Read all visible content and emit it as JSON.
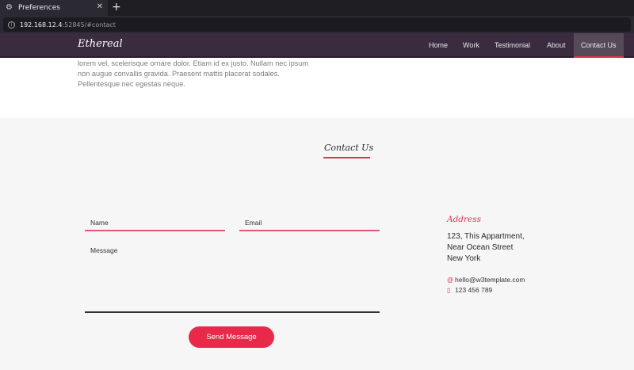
{
  "browser": {
    "tab_title": "Preferences",
    "tab_icon": "gear-icon",
    "url_host": "192.168.12.4",
    "url_rest": ":52845/#contact"
  },
  "site": {
    "brand": "Ethereal",
    "nav": [
      {
        "label": "Home"
      },
      {
        "label": "Work"
      },
      {
        "label": "Testimonial"
      },
      {
        "label": "About"
      },
      {
        "label": "Contact Us",
        "active": true
      }
    ],
    "accent_color": "#e0324e"
  },
  "intro": {
    "text_lines": [
      "lorem vel, scelerisque ornare dolor. Etiam id ex justo. Nullam nec ipsum",
      "non augue convallis gravida. Praesent mattis placerat sodales.",
      "Pellentesque nec egestas neque."
    ]
  },
  "contact": {
    "title": "Contact Us",
    "form": {
      "name_label": "Name",
      "email_label": "Email",
      "message_label": "Message",
      "send_label": "Send Message"
    },
    "address": {
      "heading": "Address",
      "lines": [
        "123, This Appartment,",
        "Near Ocean Street",
        "New York"
      ],
      "email": "hello@w3template.com",
      "phone": "123 456 789"
    }
  }
}
